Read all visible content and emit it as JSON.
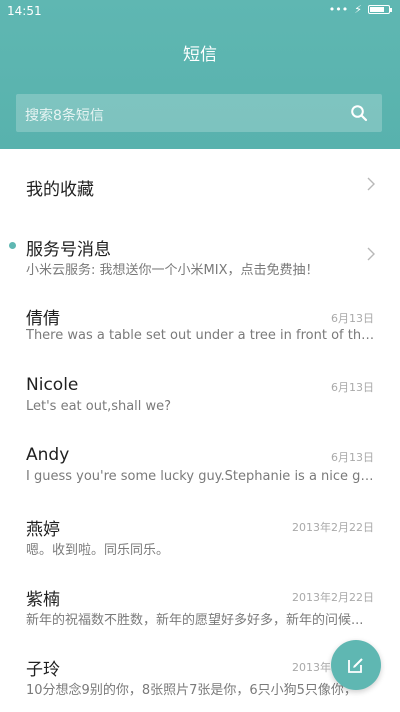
{
  "status_bar": {
    "time": "14:51",
    "icons": [
      "dots-icon",
      "charging-icon",
      "battery-icon"
    ]
  },
  "header": {
    "title": "短信"
  },
  "search": {
    "placeholder": "搜索8条短信"
  },
  "colors": {
    "accent": "#5fb7b2"
  },
  "favorites": {
    "label": "我的收藏"
  },
  "service": {
    "name": "服务号消息",
    "preview": "小米云服务: 我想送你一个小米MIX，点击免费抽！",
    "unread": true
  },
  "conversations": [
    {
      "name": "倩倩",
      "date": "6月13日",
      "preview": "There was a table set out under a tree in front of the ho..."
    },
    {
      "name": "Nicole",
      "date": "6月13日",
      "preview": "Let's eat out,shall we?"
    },
    {
      "name": "Andy",
      "date": "6月13日",
      "preview": "I guess you're some lucky guy.Stephanie is a nice girl."
    },
    {
      "name": "燕婷",
      "date": "2013年2月22日",
      "preview": "嗯。收到啦。同乐同乐。"
    },
    {
      "name": "紫楠",
      "date": "2013年2月22日",
      "preview": "新年的祝福数不胜数，新年的愿望好多好多，新年的问候..."
    },
    {
      "name": "子玲",
      "date": "2013年2月22日",
      "preview": "10分想念9别的你，8张照片7张是你，6只小狗5只像你，"
    }
  ],
  "fab": {
    "icon": "compose-icon"
  }
}
